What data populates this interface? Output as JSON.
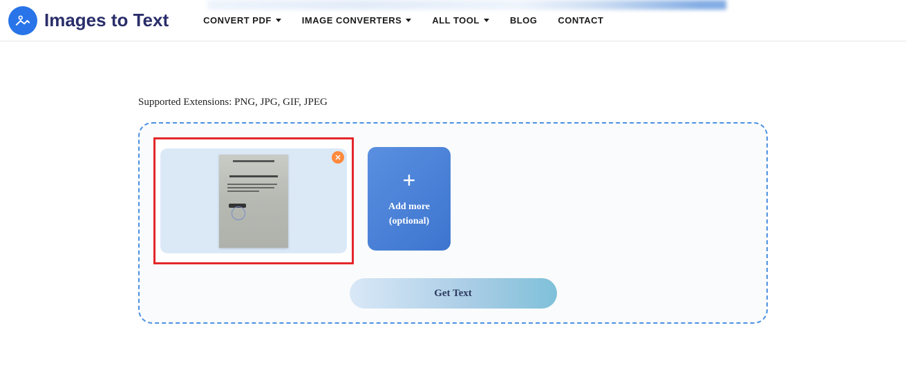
{
  "header": {
    "logo_text": "Images to Text",
    "nav": [
      {
        "label": "CONVERT PDF",
        "has_dropdown": true
      },
      {
        "label": "IMAGE CONVERTERS",
        "has_dropdown": true
      },
      {
        "label": "ALL TOOL",
        "has_dropdown": true
      },
      {
        "label": "BLOG",
        "has_dropdown": false
      },
      {
        "label": "CONTACT",
        "has_dropdown": false
      }
    ]
  },
  "main": {
    "supported_label": "Supported Extensions: PNG, JPG, GIF, JPEG",
    "add_more": {
      "line1": "Add more",
      "line2": "(optional)"
    },
    "get_text_label": "Get Text"
  }
}
